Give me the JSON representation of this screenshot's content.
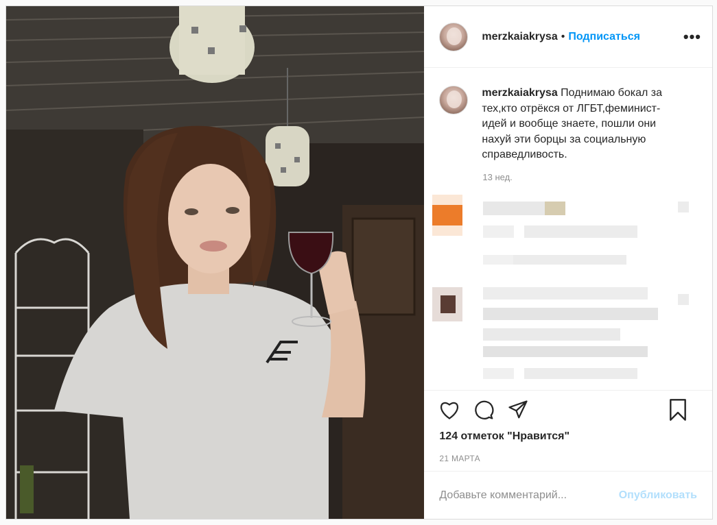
{
  "header": {
    "username": "merzkaiakrysa",
    "separator": "•",
    "follow_label": "Подписаться",
    "more_label": "•••"
  },
  "caption": {
    "username": "merzkaiakrysa",
    "text": "Поднимаю бокал за тех,кто отрёкся от ЛГБТ,феминист-идей и вообще знаете, пошли они нахуй эти борцы за социальную справедливость.",
    "time": "13 нед."
  },
  "actions": {
    "icons": [
      "heart-icon",
      "comment-icon",
      "share-icon",
      "bookmark-icon"
    ],
    "likes": "124 отметок \"Нравится\"",
    "date": "21 МАРТА"
  },
  "add_comment": {
    "placeholder": "Добавьте комментарий...",
    "publish_label": "Опубликовать"
  },
  "colors": {
    "accent": "#0095f6",
    "publish_disabled": "#b2dffc",
    "muted": "#8e8e8e",
    "border": "#dbdbdb"
  }
}
